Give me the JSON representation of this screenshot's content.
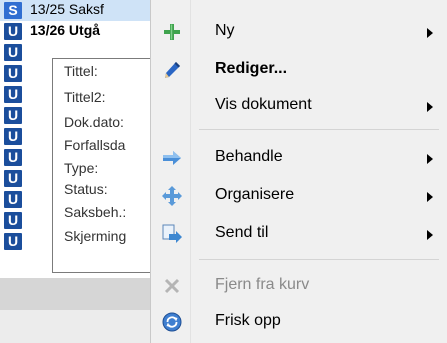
{
  "colors": {
    "badge_s": "#2f6ed1",
    "badge_u": "#1b4e9c"
  },
  "list": {
    "rows": [
      {
        "badge": "S",
        "text": "13/25 Saksf",
        "selected": true,
        "bold": false
      },
      {
        "badge": "U",
        "text": "13/26 Utgå",
        "selected": false,
        "bold": true
      },
      {
        "badge": "U",
        "text": "",
        "selected": false,
        "bold": false
      },
      {
        "badge": "U",
        "text": "",
        "selected": false,
        "bold": false
      },
      {
        "badge": "U",
        "text": "",
        "selected": false,
        "bold": false
      },
      {
        "badge": "U",
        "text": "",
        "selected": false,
        "bold": false
      },
      {
        "badge": "U",
        "text": "",
        "selected": false,
        "bold": false
      },
      {
        "badge": "U",
        "text": "",
        "selected": false,
        "bold": false
      },
      {
        "badge": "U",
        "text": "",
        "selected": false,
        "bold": false
      },
      {
        "badge": "U",
        "text": "",
        "selected": false,
        "bold": false
      },
      {
        "badge": "U",
        "text": "",
        "selected": false,
        "bold": false
      },
      {
        "badge": "U",
        "text": "",
        "selected": false,
        "bold": false
      }
    ]
  },
  "tooltip": {
    "lines": [
      "Tittel:",
      "Tittel2:",
      "Dok.dato:",
      "Forfallsda",
      "Type:",
      "Status:",
      "Saksbeh.:",
      "Skjerming"
    ]
  },
  "menu": {
    "items": [
      {
        "label": "Ny",
        "icon": "plus-icon",
        "submenu": true,
        "bold": false,
        "disabled": false
      },
      {
        "label": "Rediger...",
        "icon": "pencil-icon",
        "submenu": false,
        "bold": true,
        "disabled": false
      },
      {
        "label": "Vis dokument",
        "icon": "",
        "submenu": true,
        "bold": false,
        "disabled": false
      },
      {
        "label": "Behandle",
        "icon": "forward-arrow-icon",
        "submenu": true,
        "bold": false,
        "disabled": false
      },
      {
        "label": "Organisere",
        "icon": "move-arrows-icon",
        "submenu": true,
        "bold": false,
        "disabled": false
      },
      {
        "label": "Send til",
        "icon": "send-document-icon",
        "submenu": true,
        "bold": false,
        "disabled": false
      },
      {
        "label": "Fjern fra kurv",
        "icon": "remove-x-icon",
        "submenu": false,
        "bold": false,
        "disabled": true
      },
      {
        "label": "Frisk opp",
        "icon": "refresh-icon",
        "submenu": false,
        "bold": false,
        "disabled": false
      }
    ]
  }
}
